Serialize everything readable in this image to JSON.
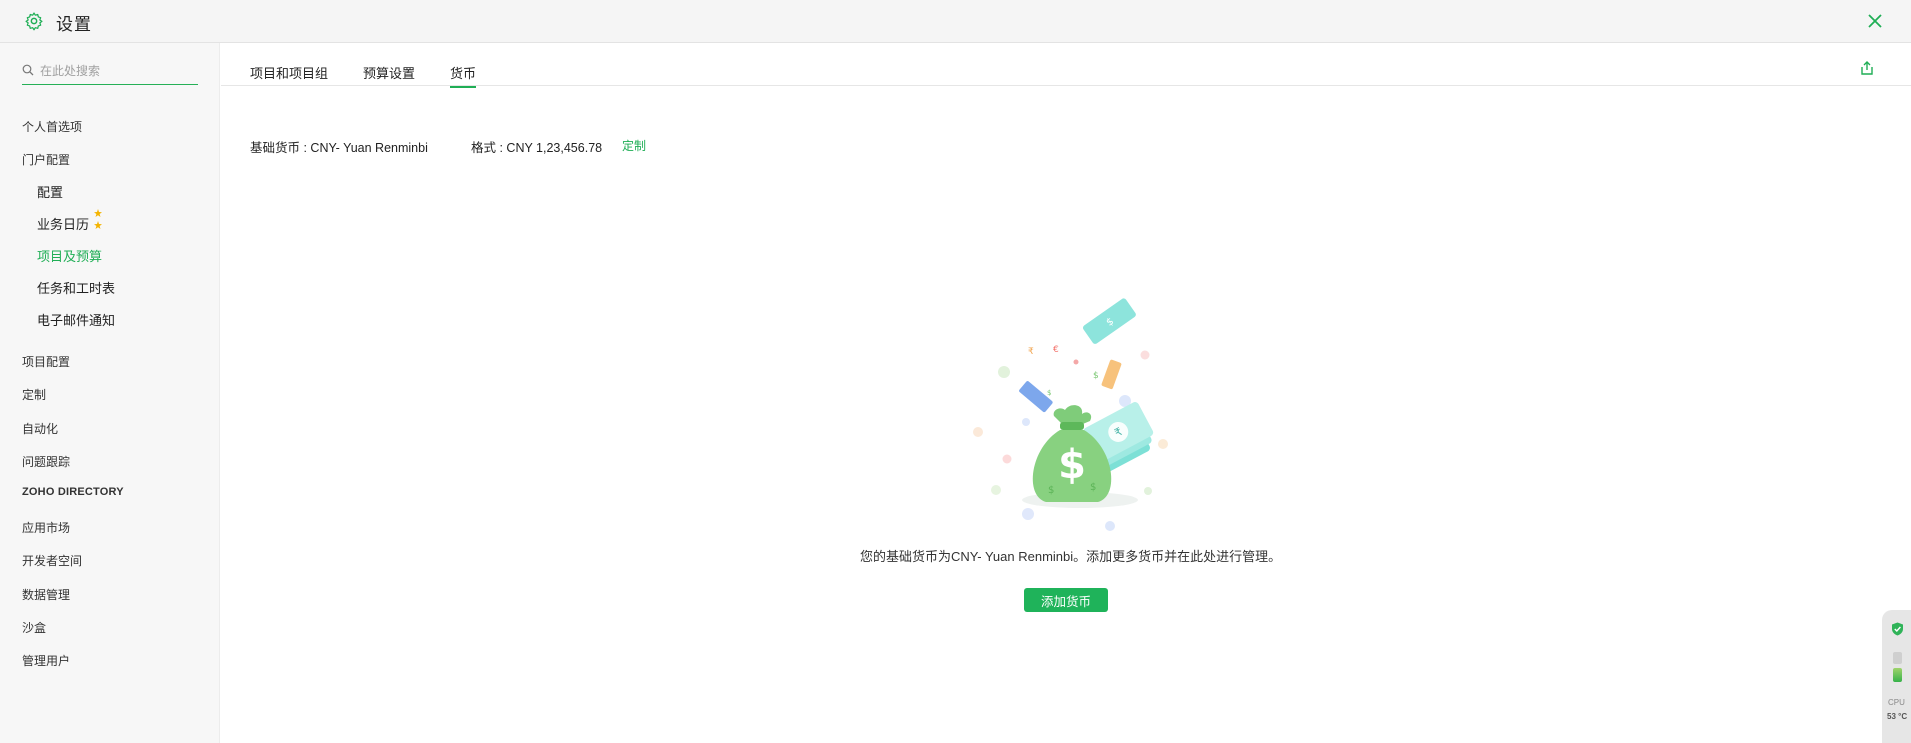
{
  "header": {
    "title": "设置"
  },
  "sidebar": {
    "search_placeholder": "在此处搜索",
    "items": [
      {
        "label": "个人首选项"
      },
      {
        "label": "门户配置"
      },
      {
        "label": "配置"
      },
      {
        "label": "业务日历"
      },
      {
        "label": "项目及预算"
      },
      {
        "label": "任务和工时表"
      },
      {
        "label": "电子邮件通知"
      },
      {
        "label": "项目配置"
      },
      {
        "label": "定制"
      },
      {
        "label": "自动化"
      },
      {
        "label": "问题跟踪"
      },
      {
        "label": "ZOHO DIRECTORY"
      },
      {
        "label": "应用市场"
      },
      {
        "label": "开发者空间"
      },
      {
        "label": "数据管理"
      },
      {
        "label": "沙盒"
      },
      {
        "label": "管理用户"
      }
    ],
    "active_item": "项目及预算"
  },
  "tabs": [
    {
      "label": "项目和项目组"
    },
    {
      "label": "预算设置"
    },
    {
      "label": "货币"
    }
  ],
  "active_tab": "货币",
  "currency": {
    "base_currency": "基础货币 : CNY- Yuan Renminbi",
    "format": "格式 : CNY 1,23,456.78",
    "customize_label": "定制",
    "empty_message": "您的基础货币为CNY- Yuan Renminbi。添加更多货币并在此处进行管理。",
    "add_button_label": "添加货币"
  },
  "widget": {
    "cpu_label": "CPU",
    "temp_label": "53 °C"
  },
  "colors": {
    "accent": "#1fae55",
    "header_bg": "#f5f5f5",
    "sidebar_bg": "#f7f7f7"
  },
  "icons": [
    "gear-icon",
    "close-icon",
    "search-icon",
    "star-icon",
    "export-icon",
    "money-bag-illustration",
    "shield-icon"
  ]
}
